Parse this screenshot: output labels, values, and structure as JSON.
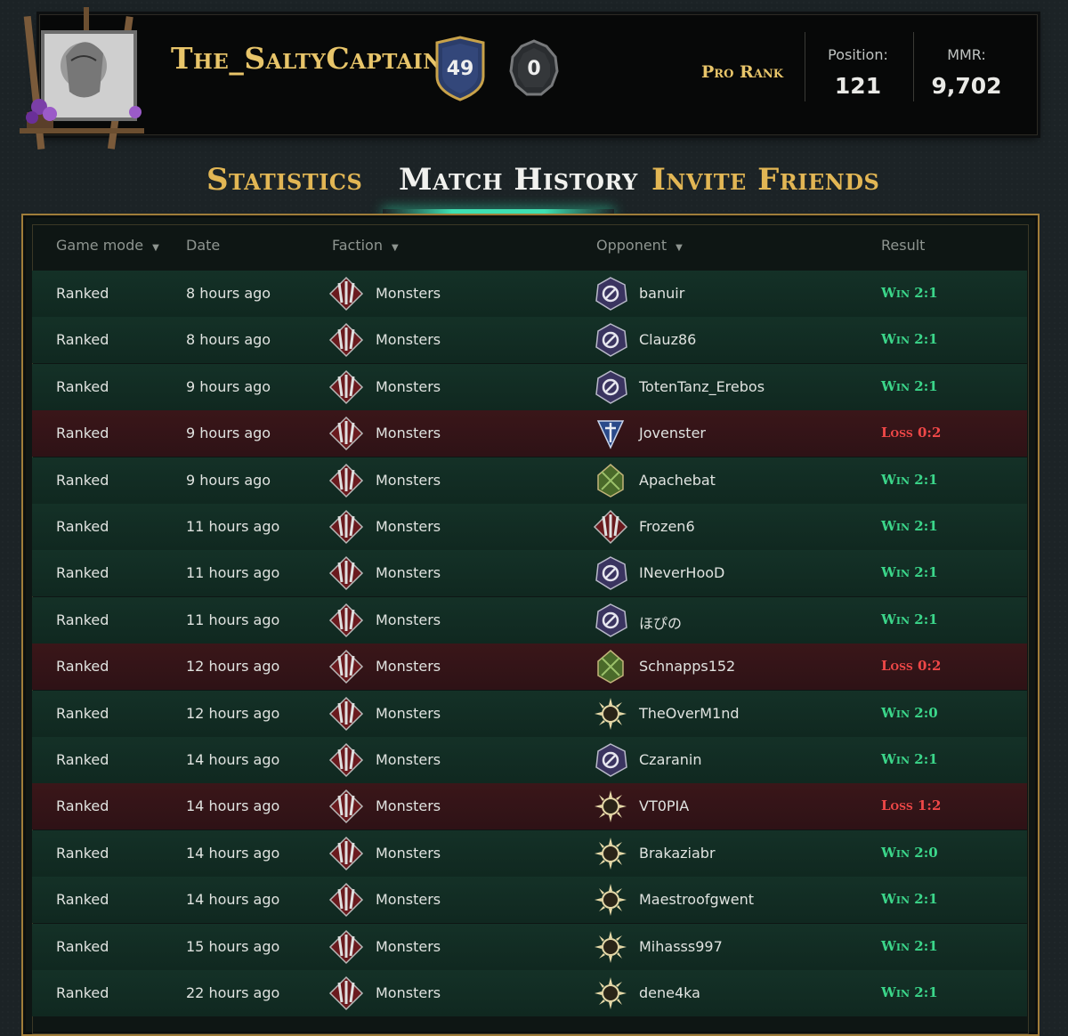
{
  "profile": {
    "username": "The_SaltyCaptain",
    "level_badge": "49",
    "prestige_badge": "0",
    "rank_label": "Pro Rank",
    "position_label": "Position:",
    "position_value": "121",
    "mmr_label": "MMR:",
    "mmr_value": "9,702"
  },
  "tabs": [
    {
      "label": "Statistics",
      "active": false
    },
    {
      "label": "Match History",
      "active": true
    },
    {
      "label": "Invite Friends",
      "active": false
    }
  ],
  "columns": {
    "game_mode": "Game mode",
    "date": "Date",
    "faction": "Faction",
    "opponent": "Opponent",
    "result": "Result"
  },
  "colors": {
    "gold": "#e8c56a",
    "win": "#3bd68a",
    "loss": "#f04848",
    "accent": "#3fe0b2"
  },
  "matches": [
    {
      "mode": "Ranked",
      "date": "8 hours ago",
      "faction": "Monsters",
      "opponent": "banuir",
      "opp_faction": "nilfgaard-icon",
      "result": "Win 2:1",
      "outcome": "win"
    },
    {
      "mode": "Ranked",
      "date": "8 hours ago",
      "faction": "Monsters",
      "opponent": "Clauz86",
      "opp_faction": "nilfgaard-icon",
      "result": "Win 2:1",
      "outcome": "win"
    },
    {
      "mode": "Ranked",
      "date": "9 hours ago",
      "faction": "Monsters",
      "opponent": "TotenTanz_Erebos",
      "opp_faction": "nilfgaard-icon",
      "result": "Win 2:1",
      "outcome": "win"
    },
    {
      "mode": "Ranked",
      "date": "9 hours ago",
      "faction": "Monsters",
      "opponent": "Jovenster",
      "opp_faction": "northern-realms-icon",
      "result": "Loss 0:2",
      "outcome": "loss"
    },
    {
      "mode": "Ranked",
      "date": "9 hours ago",
      "faction": "Monsters",
      "opponent": "Apachebat",
      "opp_faction": "scoiatael-icon",
      "result": "Win 2:1",
      "outcome": "win"
    },
    {
      "mode": "Ranked",
      "date": "11 hours ago",
      "faction": "Monsters",
      "opponent": "Frozen6",
      "opp_faction": "monsters-icon",
      "result": "Win 2:1",
      "outcome": "win"
    },
    {
      "mode": "Ranked",
      "date": "11 hours ago",
      "faction": "Monsters",
      "opponent": "INeverHooD",
      "opp_faction": "nilfgaard-icon",
      "result": "Win 2:1",
      "outcome": "win"
    },
    {
      "mode": "Ranked",
      "date": "11 hours ago",
      "faction": "Monsters",
      "opponent": "ほぴの",
      "opp_faction": "nilfgaard-icon",
      "result": "Win 2:1",
      "outcome": "win"
    },
    {
      "mode": "Ranked",
      "date": "12 hours ago",
      "faction": "Monsters",
      "opponent": "Schnapps152",
      "opp_faction": "scoiatael-icon",
      "result": "Loss 0:2",
      "outcome": "loss"
    },
    {
      "mode": "Ranked",
      "date": "12 hours ago",
      "faction": "Monsters",
      "opponent": "TheOverM1nd",
      "opp_faction": "syndicate-icon",
      "result": "Win 2:0",
      "outcome": "win"
    },
    {
      "mode": "Ranked",
      "date": "14 hours ago",
      "faction": "Monsters",
      "opponent": "Czaranin",
      "opp_faction": "nilfgaard-icon",
      "result": "Win 2:1",
      "outcome": "win"
    },
    {
      "mode": "Ranked",
      "date": "14 hours ago",
      "faction": "Monsters",
      "opponent": "VT0PIA",
      "opp_faction": "syndicate-icon",
      "result": "Loss 1:2",
      "outcome": "loss"
    },
    {
      "mode": "Ranked",
      "date": "14 hours ago",
      "faction": "Monsters",
      "opponent": "Brakaziabr",
      "opp_faction": "syndicate-icon",
      "result": "Win 2:0",
      "outcome": "win"
    },
    {
      "mode": "Ranked",
      "date": "14 hours ago",
      "faction": "Monsters",
      "opponent": "Maestroofgwent",
      "opp_faction": "syndicate-icon",
      "result": "Win 2:1",
      "outcome": "win"
    },
    {
      "mode": "Ranked",
      "date": "15 hours ago",
      "faction": "Monsters",
      "opponent": "Mihasss997",
      "opp_faction": "syndicate-icon",
      "result": "Win 2:1",
      "outcome": "win"
    },
    {
      "mode": "Ranked",
      "date": "22 hours ago",
      "faction": "Monsters",
      "opponent": "dene4ka",
      "opp_faction": "syndicate-icon",
      "result": "Win 2:1",
      "outcome": "win"
    }
  ]
}
